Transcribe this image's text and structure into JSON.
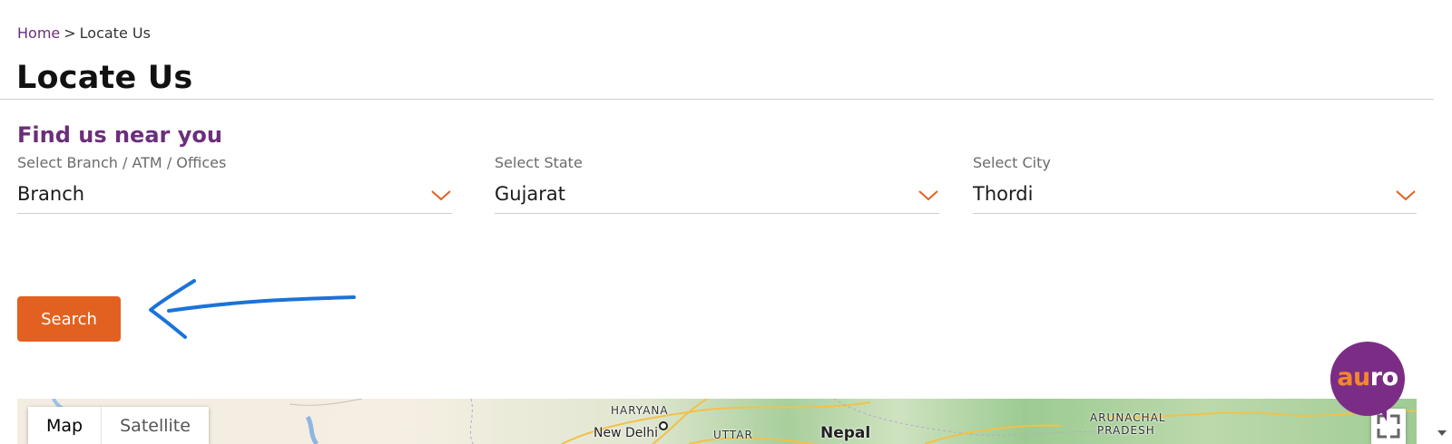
{
  "breadcrumb": {
    "home": "Home",
    "separator": ">",
    "current": "Locate Us"
  },
  "page": {
    "title": "Locate Us"
  },
  "finder": {
    "heading": "Find us near you",
    "fields": [
      {
        "label": "Select Branch / ATM / Offices",
        "value": "Branch"
      },
      {
        "label": "Select State",
        "value": "Gujarat"
      },
      {
        "label": "Select City",
        "value": "Thordi"
      }
    ],
    "search_label": "Search"
  },
  "map": {
    "types": [
      "Map",
      "Satellite"
    ],
    "selected_type": "Map",
    "labels": {
      "haryana": "HARYANA",
      "new_delhi": "New Delhi",
      "uttar": "UTTAR",
      "nepal": "Nepal",
      "arunachal": "ARUNACHAL",
      "pradesh": "PRADESH"
    },
    "fullscreen_icon": "fullscreen-icon"
  },
  "chat": {
    "logo_prefix": "au",
    "logo_suffix": "ro"
  },
  "colors": {
    "accent_orange": "#e26121",
    "brand_purple": "#6b2f7a",
    "annotation_blue": "#1a73d9"
  }
}
